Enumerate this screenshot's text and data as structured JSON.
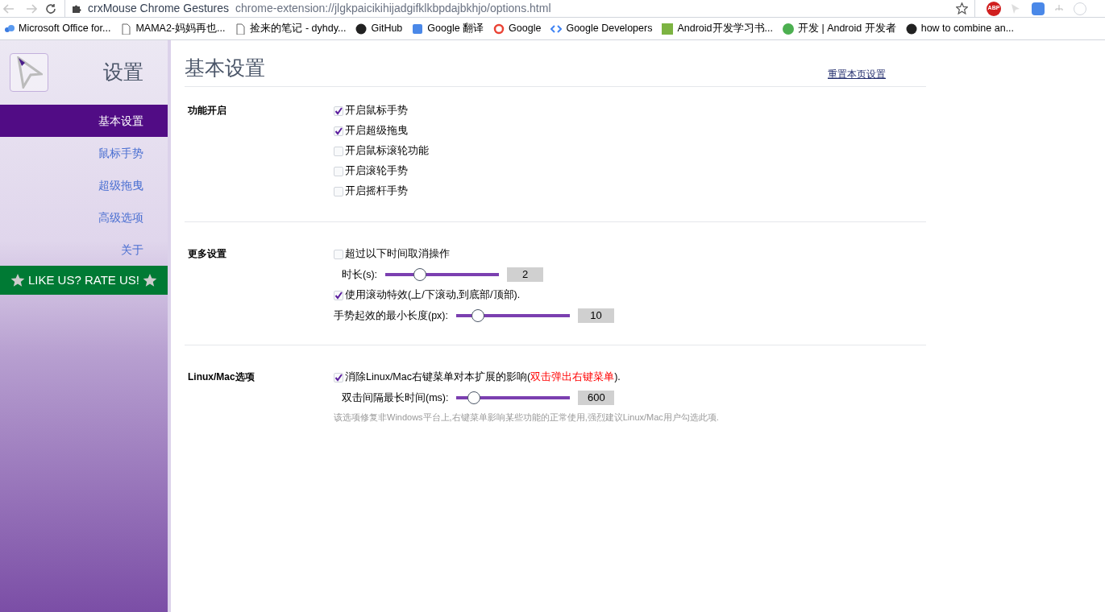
{
  "browser": {
    "tab_title": "crxMouse Chrome Gestures",
    "url": "chrome-extension://jlgkpaicikihijadgifklkbpdajbkhjo/options.html",
    "extension_badge": "ABP"
  },
  "bookmarks": [
    {
      "label": "Microsoft Office for...",
      "kind": "cloud"
    },
    {
      "label": "MAMA2-妈妈再也...",
      "kind": "page"
    },
    {
      "label": "捡来的笔记 - dyhdy...",
      "kind": "page"
    },
    {
      "label": "GitHub",
      "kind": "github"
    },
    {
      "label": "Google 翻译",
      "kind": "translate"
    },
    {
      "label": "Google",
      "kind": "google"
    },
    {
      "label": "Google Developers",
      "kind": "dev"
    },
    {
      "label": "Android开发学习书...",
      "kind": "book"
    },
    {
      "label": "开发 | Android 开发者",
      "kind": "android"
    },
    {
      "label": "how to combine an...",
      "kind": "github"
    }
  ],
  "sidebar": {
    "title": "设置",
    "items": [
      {
        "label": "基本设置",
        "selected": true
      },
      {
        "label": "鼠标手势",
        "selected": false
      },
      {
        "label": "超级拖曳",
        "selected": false
      },
      {
        "label": "高级选项",
        "selected": false
      },
      {
        "label": "关于",
        "selected": false
      }
    ],
    "rate_button": "LIKE US? RATE US!"
  },
  "page": {
    "title": "基本设置",
    "reset_link": "重置本页设置",
    "sections": [
      {
        "heading": "功能开启",
        "rows": [
          {
            "kind": "checkbox",
            "label": "开启鼠标手势",
            "checked": true
          },
          {
            "kind": "checkbox",
            "label": "开启超级拖曳",
            "checked": true
          },
          {
            "kind": "checkbox",
            "label": "开启鼠标滚轮功能",
            "checked": false
          },
          {
            "kind": "checkbox",
            "label": "开启滚轮手势",
            "checked": false
          },
          {
            "kind": "checkbox",
            "label": "开启摇杆手势",
            "checked": false
          }
        ]
      },
      {
        "heading": "更多设置",
        "rows": [
          {
            "kind": "checkbox",
            "label": "超过以下时间取消操作",
            "checked": false
          },
          {
            "kind": "slider",
            "label": "时长(s):",
            "level": 0.28,
            "value": "2",
            "indent": true
          },
          {
            "kind": "checkbox",
            "label": "使用滚动特效(上/下滚动,到底部/顶部).",
            "checked": true
          },
          {
            "kind": "slider",
            "label": "手势起效的最小长度(px):",
            "level": 0.15,
            "value": "10",
            "indent": false
          }
        ]
      },
      {
        "heading": "Linux/Mac选项",
        "rows": [
          {
            "kind": "checkbox",
            "label": "消除Linux/Mac右键菜单对本扩展的影响(",
            "highlight": "双击弹出右键菜单",
            "label_end": ").",
            "checked": true
          },
          {
            "kind": "slider",
            "label": "双击间隔最长时间(ms):",
            "level": 0.11,
            "value": "600",
            "indent": true
          },
          {
            "kind": "note",
            "label": "该选项修复非Windows平台上,右键菜单影响某些功能的正常使用,强烈建议Linux/Mac用户勾选此项."
          }
        ]
      }
    ]
  }
}
